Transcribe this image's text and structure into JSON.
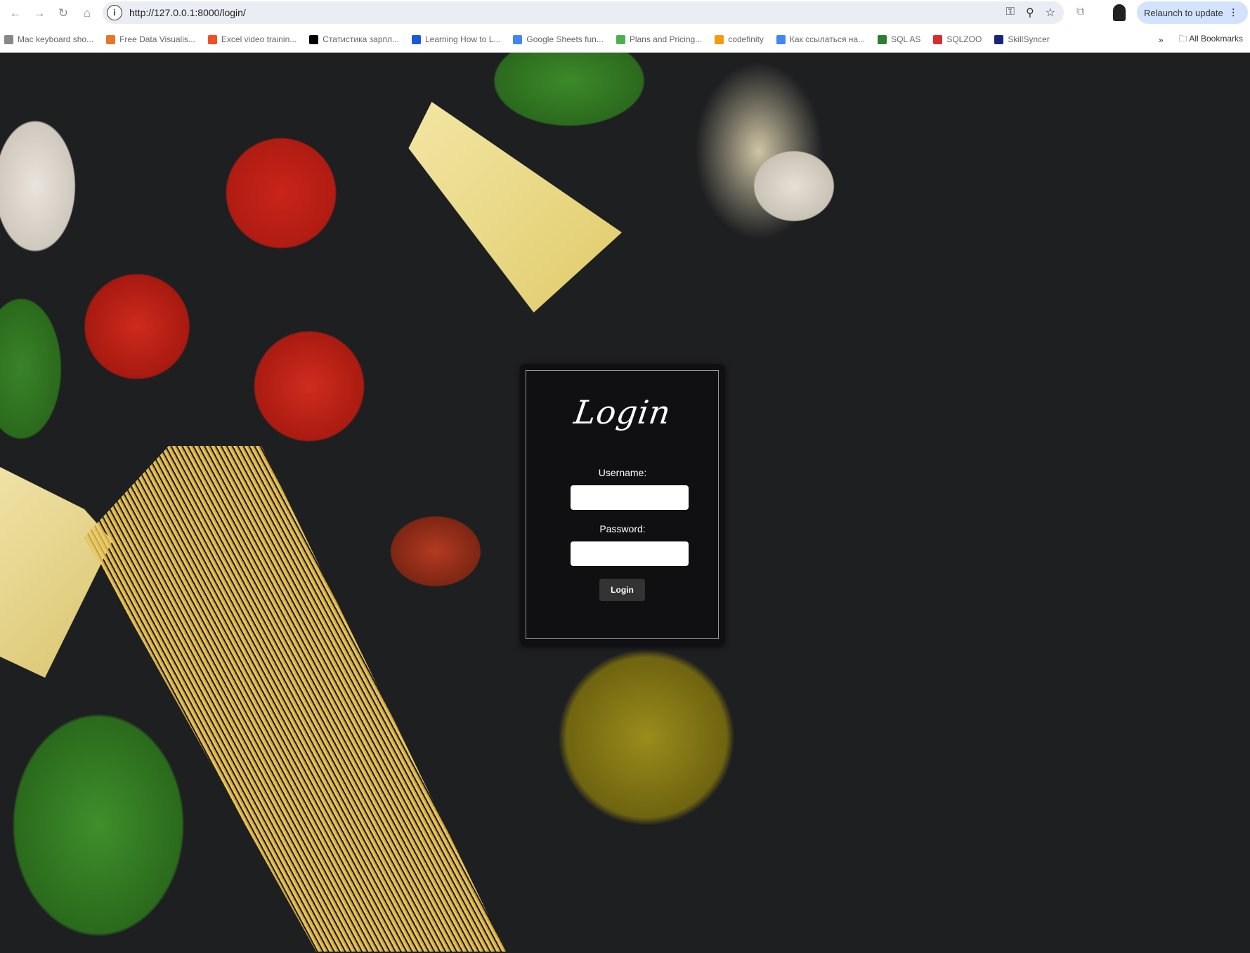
{
  "browser": {
    "url": "http://127.0.0.1:8000/login/",
    "relaunch_label": "Relaunch to update",
    "bookmarks": [
      {
        "label": "Mac keyboard sho...",
        "color": "#888888"
      },
      {
        "label": "Free Data Visualis...",
        "color": "#e97627"
      },
      {
        "label": "Excel video trainin...",
        "color": "#f25022"
      },
      {
        "label": "Статистика зарпл...",
        "color": "#000000"
      },
      {
        "label": "Learning How to L...",
        "color": "#1a5ad7"
      },
      {
        "label": "Google Sheets fun...",
        "color": "#4285f4"
      },
      {
        "label": "Plans and Pricing...",
        "color": "#4caf50"
      },
      {
        "label": "codefinity",
        "color": "#f39c12"
      },
      {
        "label": "Как ссылаться на...",
        "color": "#4285f4"
      },
      {
        "label": "SQL AS",
        "color": "#2e7d32"
      },
      {
        "label": "SQLZOO",
        "color": "#d32f2f"
      },
      {
        "label": "SkillSyncer",
        "color": "#1a237e"
      }
    ],
    "all_bookmarks_label": "All Bookmarks"
  },
  "login": {
    "title": "Login",
    "username_label": "Username:",
    "username_value": "",
    "password_label": "Password:",
    "password_value": "",
    "submit_label": "Login"
  }
}
